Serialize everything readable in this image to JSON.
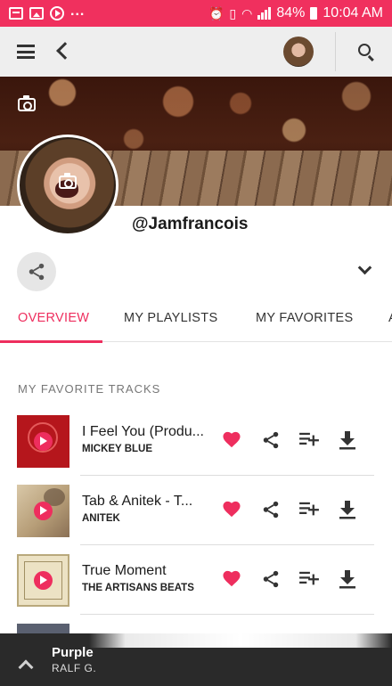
{
  "status_bar": {
    "notification_icons": [
      "calendar-icon",
      "image-icon",
      "play-circle-icon"
    ],
    "overflow": "...",
    "battery": "84%",
    "time": "10:04 AM",
    "colors": {
      "background": "#f0305e"
    }
  },
  "app_bar": {
    "icons": [
      "menu-icon",
      "back-arrow-icon",
      "search-icon"
    ]
  },
  "profile": {
    "username": "@Jamfrancois"
  },
  "tabs": [
    {
      "label": "OVERVIEW",
      "active": true
    },
    {
      "label": "MY PLAYLISTS",
      "active": false
    },
    {
      "label": "MY FAVORITES",
      "active": false
    },
    {
      "label": "A",
      "active": false
    }
  ],
  "section": {
    "title": "MY FAVORITE TRACKS"
  },
  "tracks": [
    {
      "title": "I Feel You (Produ...",
      "artist": "MICKEY BLUE",
      "favorited": true
    },
    {
      "title": "Tab & Anitek - T...",
      "artist": "ANITEK",
      "favorited": true
    },
    {
      "title": "True Moment",
      "artist": "THE ARTISANS BEATS",
      "favorited": true
    }
  ],
  "mini_player": {
    "title": "Purple",
    "artist": "RALF G."
  },
  "colors": {
    "accent": "#ee2e5e",
    "app_bar": "#eeeeee",
    "player": "#2a2a2a"
  }
}
